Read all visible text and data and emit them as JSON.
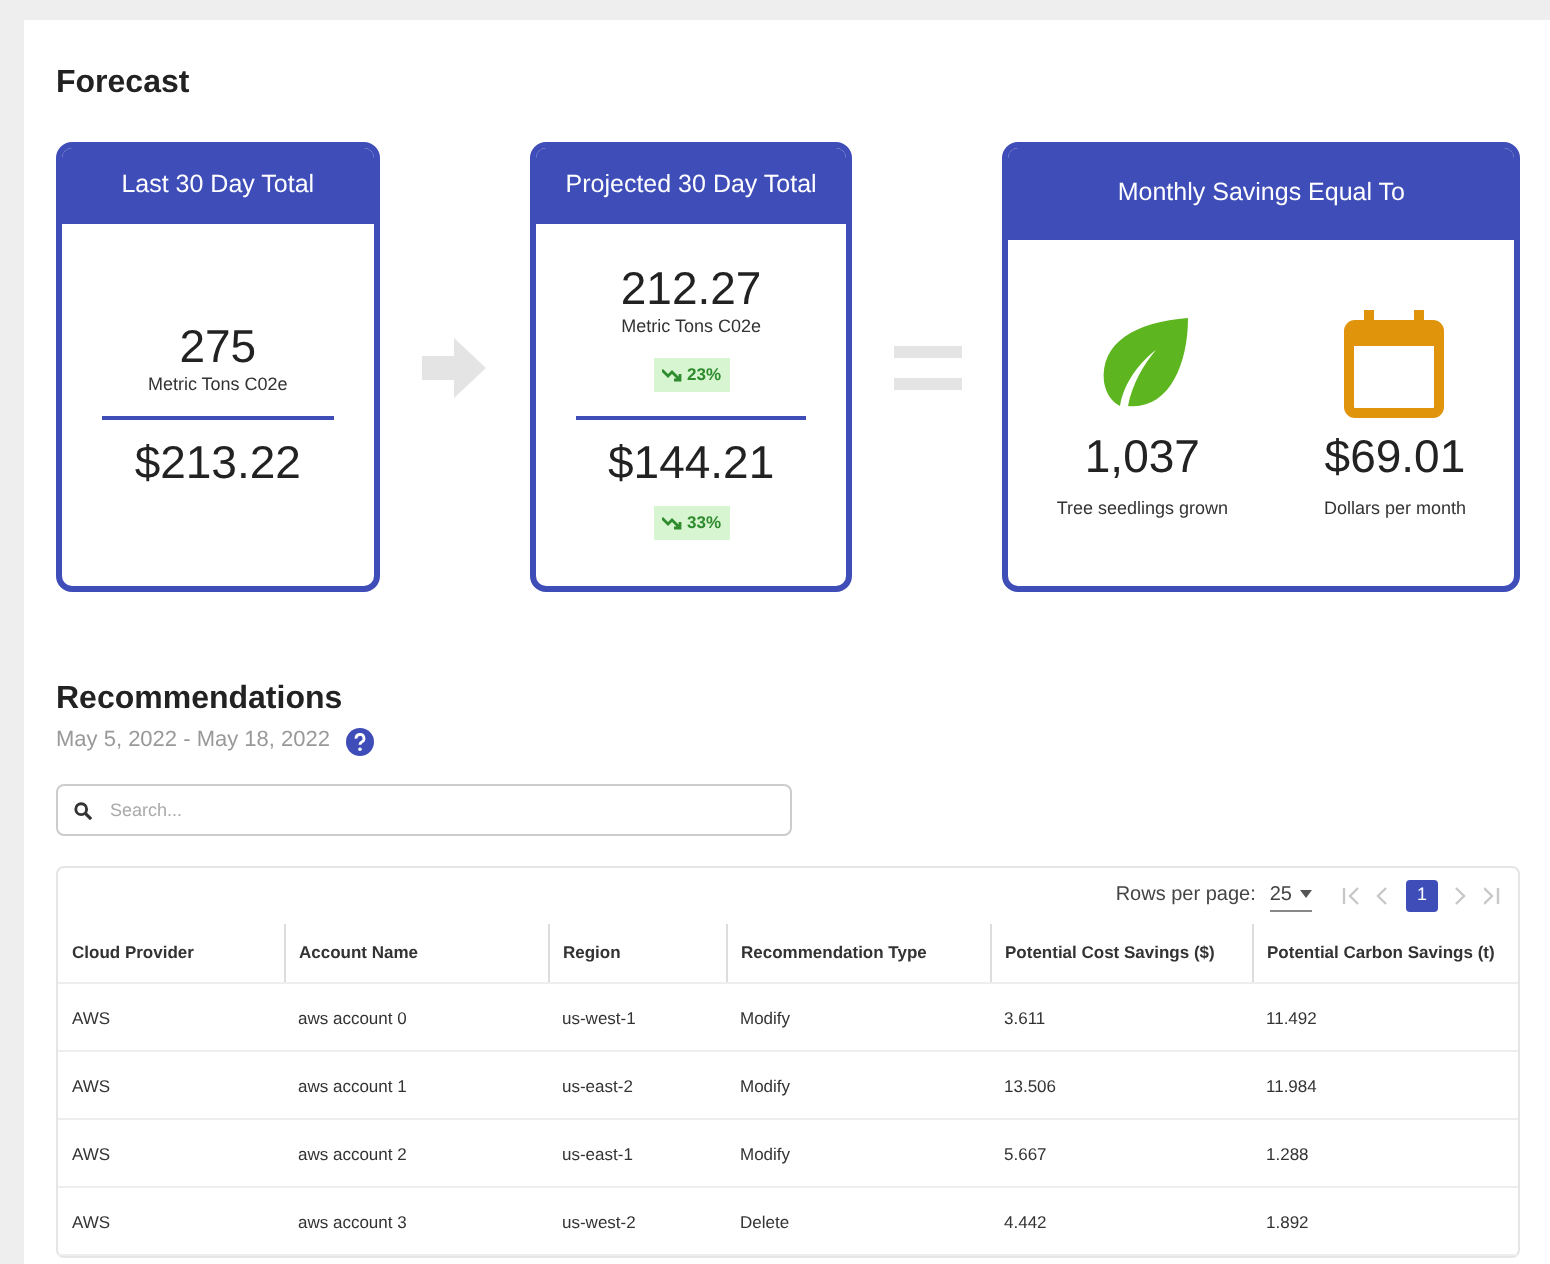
{
  "forecast": {
    "title": "Forecast",
    "last_30_day": {
      "header": "Last 30 Day Total",
      "metric_value": "275",
      "metric_unit": "Metric Tons C02e",
      "cost": "$213.22"
    },
    "projected_30_day": {
      "header": "Projected 30 Day Total",
      "metric_value": "212.27",
      "metric_unit": "Metric Tons C02e",
      "metric_change": {
        "text": "23%",
        "down": true
      },
      "cost": "$144.21",
      "cost_change": {
        "text": "33%",
        "down": true
      }
    },
    "monthly_savings": {
      "header": "Monthly Savings Equal To",
      "items": [
        {
          "kind": "tree",
          "value": "1,037",
          "label": "Tree seedlings grown"
        },
        {
          "kind": "calendar",
          "value": "$69.01",
          "label": "Dollars per month"
        }
      ]
    }
  },
  "recommendations": {
    "title": "Recommendations",
    "date_range": "May 5, 2022 - May 18, 2022",
    "search": {
      "placeholder": "Search..."
    },
    "pagination": {
      "rows_per_page_label": "Rows per page:",
      "rows_per_page": "25",
      "nav": [
        {
          "kind": "first",
          "disabled": true
        },
        {
          "kind": "prev",
          "disabled": true
        },
        {
          "kind": "page",
          "label": "1",
          "selected": true
        },
        {
          "kind": "next",
          "disabled": true
        },
        {
          "kind": "last",
          "disabled": true
        }
      ]
    },
    "table": {
      "columns": [
        "Cloud Provider",
        "Account Name",
        "Region",
        "Recommendation Type",
        "Potential Cost Savings ($)",
        "Potential Carbon Savings (t)"
      ],
      "rows": [
        [
          "AWS",
          "aws account 0",
          "us-west-1",
          "Modify",
          "3.611",
          "11.492"
        ],
        [
          "AWS",
          "aws account 1",
          "us-east-2",
          "Modify",
          "13.506",
          "11.984"
        ],
        [
          "AWS",
          "aws account 2",
          "us-east-1",
          "Modify",
          "5.667",
          "1.288"
        ],
        [
          "AWS",
          "aws account 3",
          "us-west-2",
          "Delete",
          "4.442",
          "1.892"
        ]
      ]
    }
  }
}
